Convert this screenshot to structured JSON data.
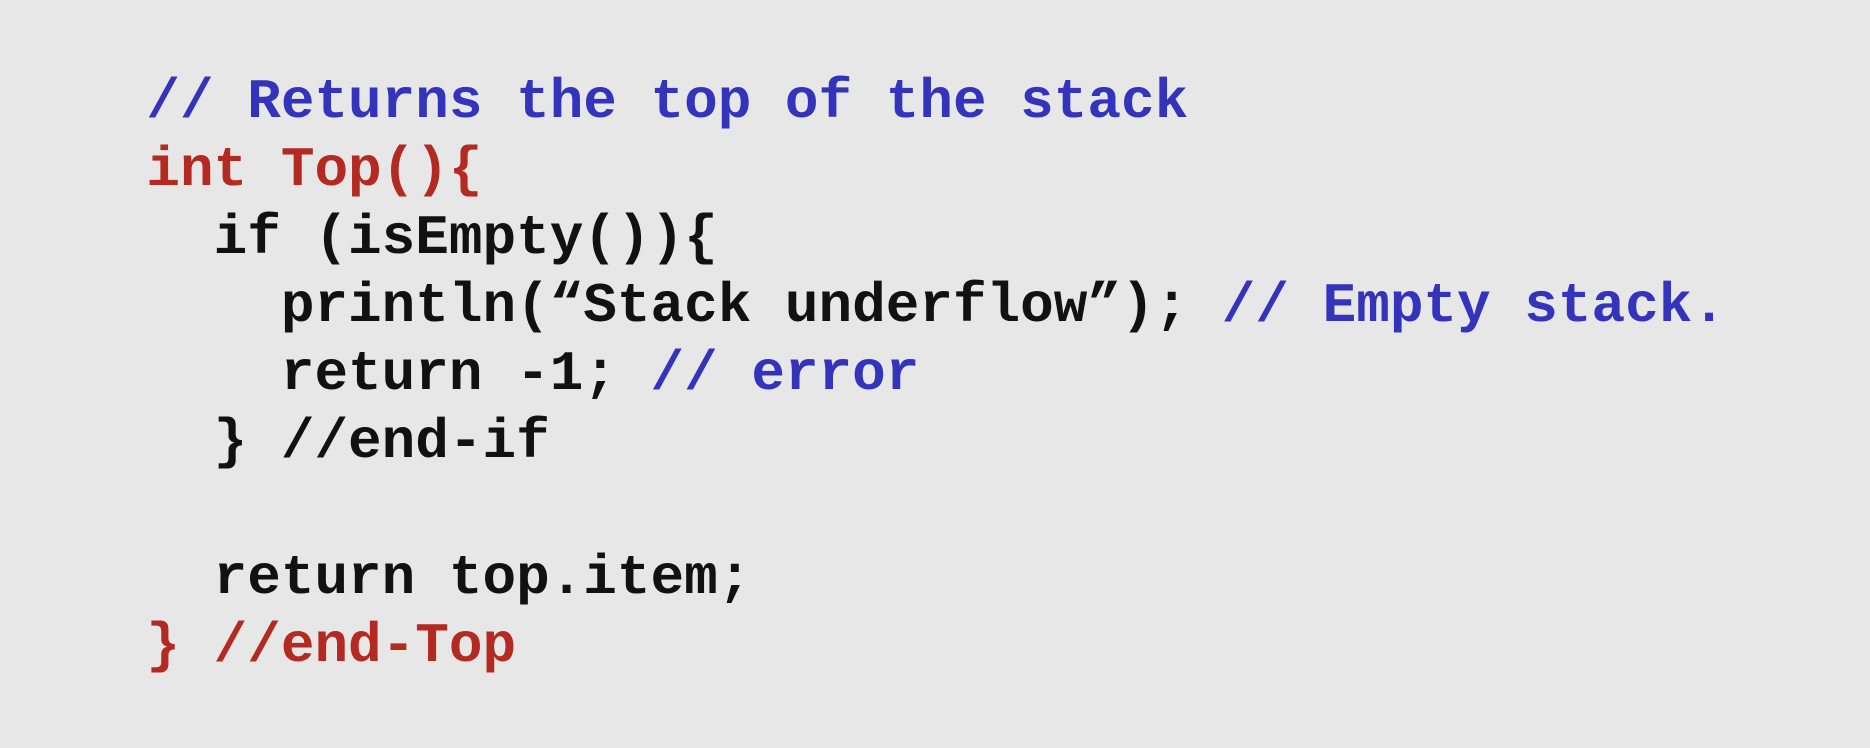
{
  "colors": {
    "background": "#e7e7e7",
    "comment": "#3333bb",
    "keyword_red": "#b22a22",
    "code_black": "#111111"
  },
  "code": {
    "lines": [
      {
        "tokens": [
          {
            "text": "// Returns the top of the stack",
            "style": "comment"
          }
        ]
      },
      {
        "tokens": [
          {
            "text": "int Top(){",
            "style": "keyword_red"
          }
        ]
      },
      {
        "tokens": [
          {
            "text": "  if (isEmpty()){",
            "style": "code_black"
          }
        ]
      },
      {
        "tokens": [
          {
            "text": "    println(“Stack underflow”); ",
            "style": "code_black"
          },
          {
            "text": "// Empty stack.",
            "style": "comment"
          }
        ]
      },
      {
        "tokens": [
          {
            "text": "    return -1; ",
            "style": "code_black"
          },
          {
            "text": "// error",
            "style": "comment"
          }
        ]
      },
      {
        "tokens": [
          {
            "text": "  } //end-if",
            "style": "code_black"
          }
        ]
      },
      {
        "tokens": [
          {
            "text": "",
            "style": "code_black"
          }
        ]
      },
      {
        "tokens": [
          {
            "text": "  return top.item;",
            "style": "code_black"
          }
        ]
      },
      {
        "tokens": [
          {
            "text": "} //end-Top",
            "style": "keyword_red"
          }
        ]
      }
    ]
  }
}
